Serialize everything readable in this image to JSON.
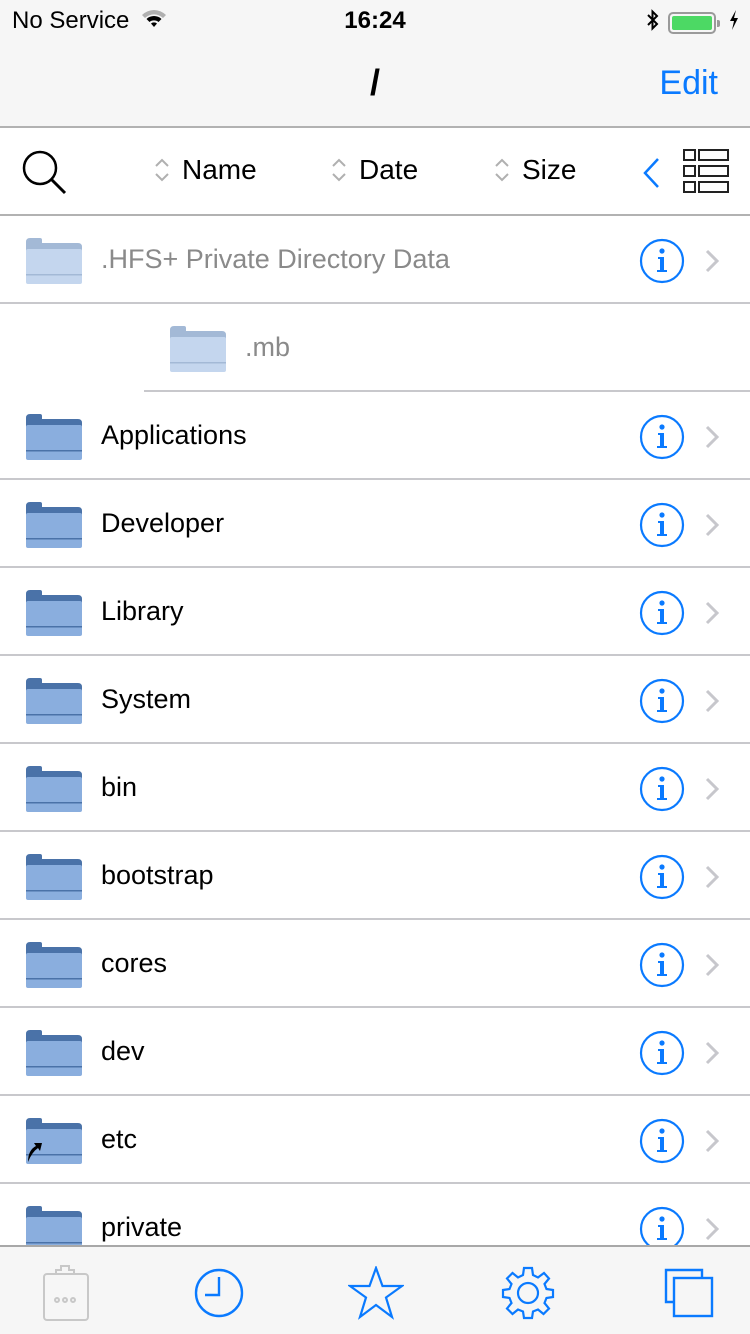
{
  "status_bar": {
    "carrier": "No Service",
    "time": "16:24",
    "wifi_icon": "wifi-icon",
    "bluetooth_icon": "bluetooth-icon",
    "battery_level": 1.0,
    "charging_icon": "bolt-icon"
  },
  "nav": {
    "title": "/",
    "edit_label": "Edit"
  },
  "sortbar": {
    "search_icon": "search-icon",
    "columns": [
      {
        "label": "Name"
      },
      {
        "label": "Date"
      },
      {
        "label": "Size"
      }
    ],
    "back_icon": "chevron-left-icon",
    "view_icon": "list-view-icon"
  },
  "files": [
    {
      "name": ".HFS+ Private Directory Data",
      "type": "folder",
      "hidden": true,
      "indent": 0,
      "symlink": false,
      "has_info": true
    },
    {
      "name": ".mb",
      "type": "folder",
      "hidden": true,
      "indent": 1,
      "symlink": false,
      "has_info": false
    },
    {
      "name": "Applications",
      "type": "folder",
      "hidden": false,
      "indent": 0,
      "symlink": false,
      "has_info": true
    },
    {
      "name": "Developer",
      "type": "folder",
      "hidden": false,
      "indent": 0,
      "symlink": false,
      "has_info": true
    },
    {
      "name": "Library",
      "type": "folder",
      "hidden": false,
      "indent": 0,
      "symlink": false,
      "has_info": true
    },
    {
      "name": "System",
      "type": "folder",
      "hidden": false,
      "indent": 0,
      "symlink": false,
      "has_info": true
    },
    {
      "name": "bin",
      "type": "folder",
      "hidden": false,
      "indent": 0,
      "symlink": false,
      "has_info": true
    },
    {
      "name": "bootstrap",
      "type": "folder",
      "hidden": false,
      "indent": 0,
      "symlink": false,
      "has_info": true
    },
    {
      "name": "cores",
      "type": "folder",
      "hidden": false,
      "indent": 0,
      "symlink": false,
      "has_info": true
    },
    {
      "name": "dev",
      "type": "folder",
      "hidden": false,
      "indent": 0,
      "symlink": false,
      "has_info": true
    },
    {
      "name": "etc",
      "type": "folder",
      "hidden": false,
      "indent": 0,
      "symlink": true,
      "has_info": true
    },
    {
      "name": "private",
      "type": "folder",
      "hidden": false,
      "indent": 0,
      "symlink": false,
      "has_info": true
    }
  ],
  "tabbar": {
    "tabs": [
      {
        "icon": "clipboard-icon",
        "enabled": false
      },
      {
        "icon": "clock-icon",
        "enabled": true
      },
      {
        "icon": "star-icon",
        "enabled": true
      },
      {
        "icon": "gear-icon",
        "enabled": true
      },
      {
        "icon": "windows-icon",
        "enabled": true
      }
    ]
  },
  "colors": {
    "accent": "#0a7aff",
    "folder_body": "#8aaede",
    "folder_tab": "#4a72a8",
    "folder_body_dim": "#c4d6ee",
    "folder_tab_dim": "#a3b9d6",
    "battery": "#4cd964"
  }
}
